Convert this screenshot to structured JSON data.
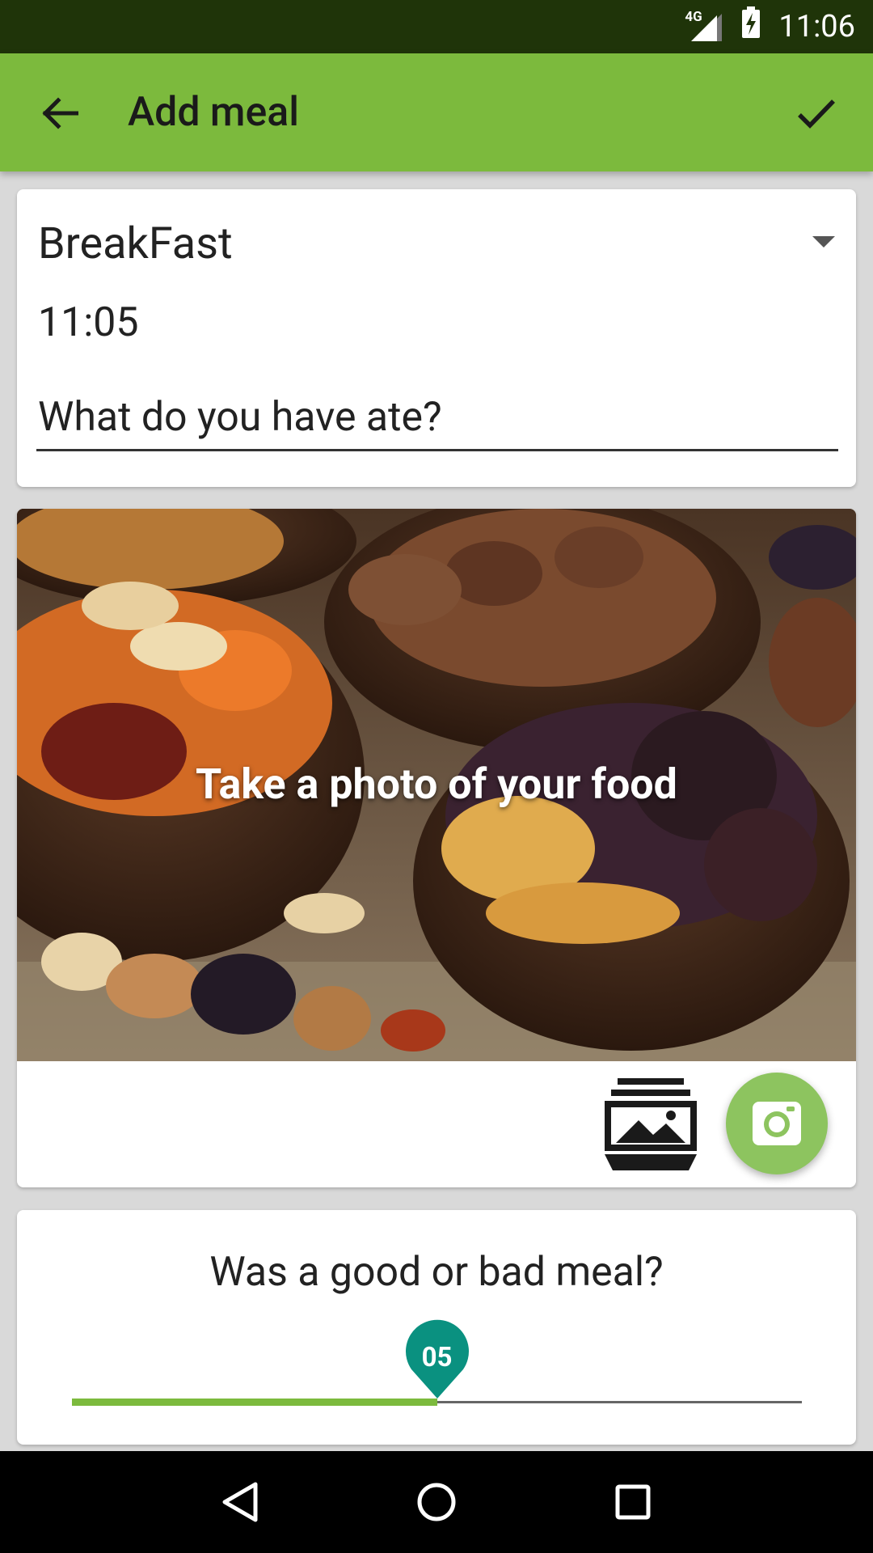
{
  "status_bar": {
    "network": "4G",
    "time": "11:06",
    "icons": [
      "signal-icon",
      "battery-charging-icon"
    ]
  },
  "app_bar": {
    "title": "Add meal",
    "back_icon": "arrow-back-icon",
    "confirm_icon": "check-icon",
    "color": "#7cba3d"
  },
  "meal_card": {
    "meal_type": "BreakFast",
    "time": "11:05",
    "food_placeholder": "What do you have ate?",
    "food_value": ""
  },
  "photo_card": {
    "caption": "Take a photo of your food",
    "gallery_icon": "gallery-icon",
    "camera_icon": "camera-icon",
    "fab_color": "#8dc45f"
  },
  "rating_card": {
    "question": "Was a good or bad meal?",
    "value_label": "05",
    "value": 5,
    "max": 10,
    "thumb_color": "#0a9180",
    "fill_color": "#7cba3d"
  },
  "nav_bar": {
    "buttons": [
      "back-triangle-icon",
      "home-circle-icon",
      "recents-square-icon"
    ]
  }
}
